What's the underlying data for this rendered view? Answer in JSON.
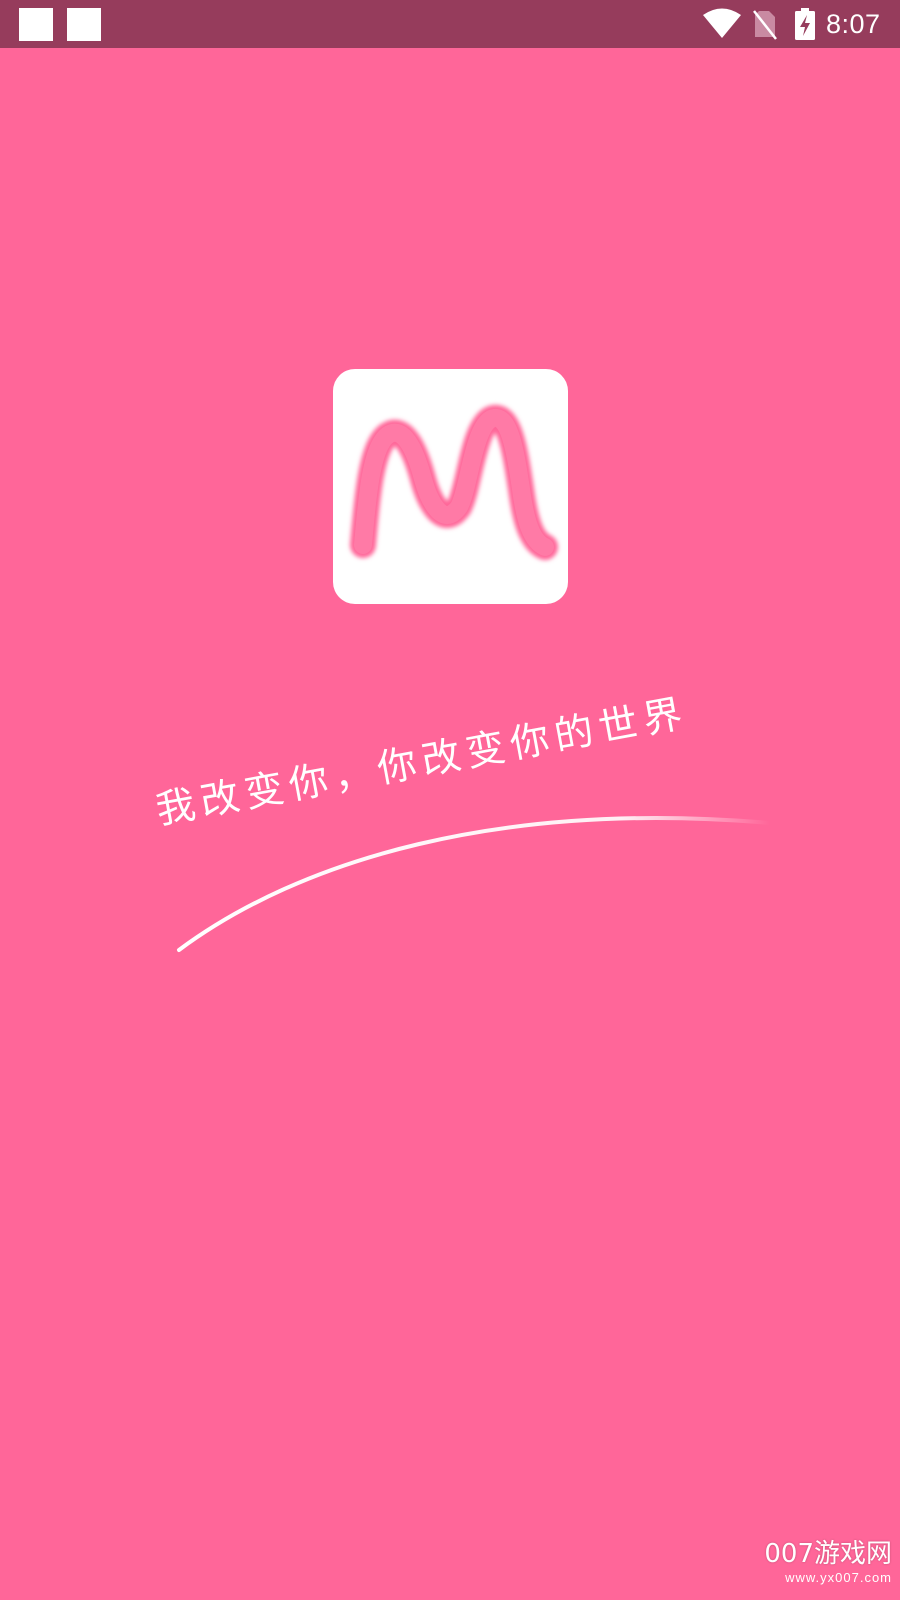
{
  "status_bar": {
    "time": "8:07",
    "icons": [
      "notification-square-icon",
      "notification-square-icon",
      "wifi-icon",
      "no-sim-icon",
      "battery-charging-icon"
    ]
  },
  "splash": {
    "logo_icon": "m-logo-icon",
    "slogan": "我改变你，你改变你的世界"
  },
  "watermark": {
    "title": "007游戏网",
    "url": "www.yx007.com"
  },
  "colors": {
    "background": "#ff6699",
    "status_bar": "#963c5c",
    "logo_letter": "#ff6699",
    "text": "#ffffff"
  }
}
